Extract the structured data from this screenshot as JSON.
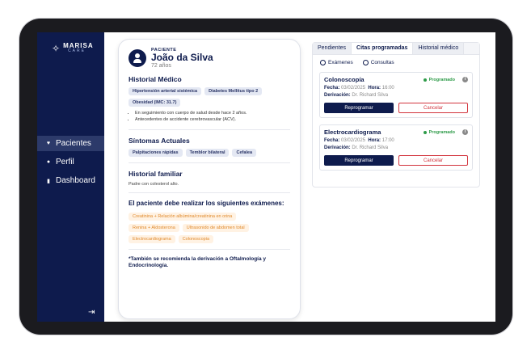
{
  "brand": {
    "name": "MARISA",
    "sub": "CARE"
  },
  "sidebar": {
    "items": [
      {
        "label": "Pacientes",
        "icon": "heart-icon"
      },
      {
        "label": "Perfil",
        "icon": "user-icon"
      },
      {
        "label": "Dashboard",
        "icon": "bar-chart-icon"
      }
    ],
    "logout_icon": "logout-icon"
  },
  "patient": {
    "tag": "PACIENTE",
    "name": "João da Silva",
    "age": "72 años",
    "history": {
      "title": "Historial Médico",
      "tags": [
        "Hipertensión arterial sistémica",
        "Diabetes Mellitus tipo 2",
        "Obesidad (IMC: 31.7)"
      ],
      "notes": [
        "En seguimiento con cuerpo de salud desde hace 2 años.",
        "Antecedentes de accidente cerebrovascular (ACV)."
      ]
    },
    "symptoms": {
      "title": "Síntomas Actuales",
      "tags": [
        "Palpitaciones rápidas",
        "Temblor bilateral",
        "Cefalea"
      ]
    },
    "family": {
      "title": "Historial familiar",
      "text": "Padre con colesterol alto."
    },
    "exams": {
      "title": "El paciente debe realizar los siguientes exámenes:",
      "tags": [
        "Creatinina + Relación albúmina/creatinina en orina",
        "Renina + Aldosterona",
        "Ultrasonido de abdomen total",
        "Electrocardiograma",
        "Colonoscopia"
      ]
    },
    "footnote": "*También se recomienda la derivación a Oftalmología y Endocrinología."
  },
  "panel": {
    "tabs": [
      "Pendientes",
      "Citas programadas",
      "Historial médico"
    ],
    "active_tab": "Citas programadas",
    "filters": [
      "Exámenes",
      "Consultas"
    ],
    "appointments": [
      {
        "title": "Colonoscopía",
        "status": "Programado",
        "fecha_label": "Fecha:",
        "fecha": "03/02/2025",
        "hora_label": "Hora:",
        "hora": "16:00",
        "deriv_label": "Derivación:",
        "deriv": "Dr. Richard Silva",
        "primary": "Reprogramar",
        "secondary": "Cancelar"
      },
      {
        "title": "Electrocardiograma",
        "status": "Programado",
        "fecha_label": "Fecha:",
        "fecha": "03/02/2025",
        "hora_label": "Hora:",
        "hora": "17:00",
        "deriv_label": "Derivación:",
        "deriv": "Dr. Richard Silva",
        "primary": "Reprogramar",
        "secondary": "Cancelar"
      }
    ]
  },
  "colors": {
    "navy": "#0e1b4d",
    "status_green": "#2e9b49",
    "cancel_red": "#d2343d",
    "exam_orange": "#e08a2c"
  }
}
